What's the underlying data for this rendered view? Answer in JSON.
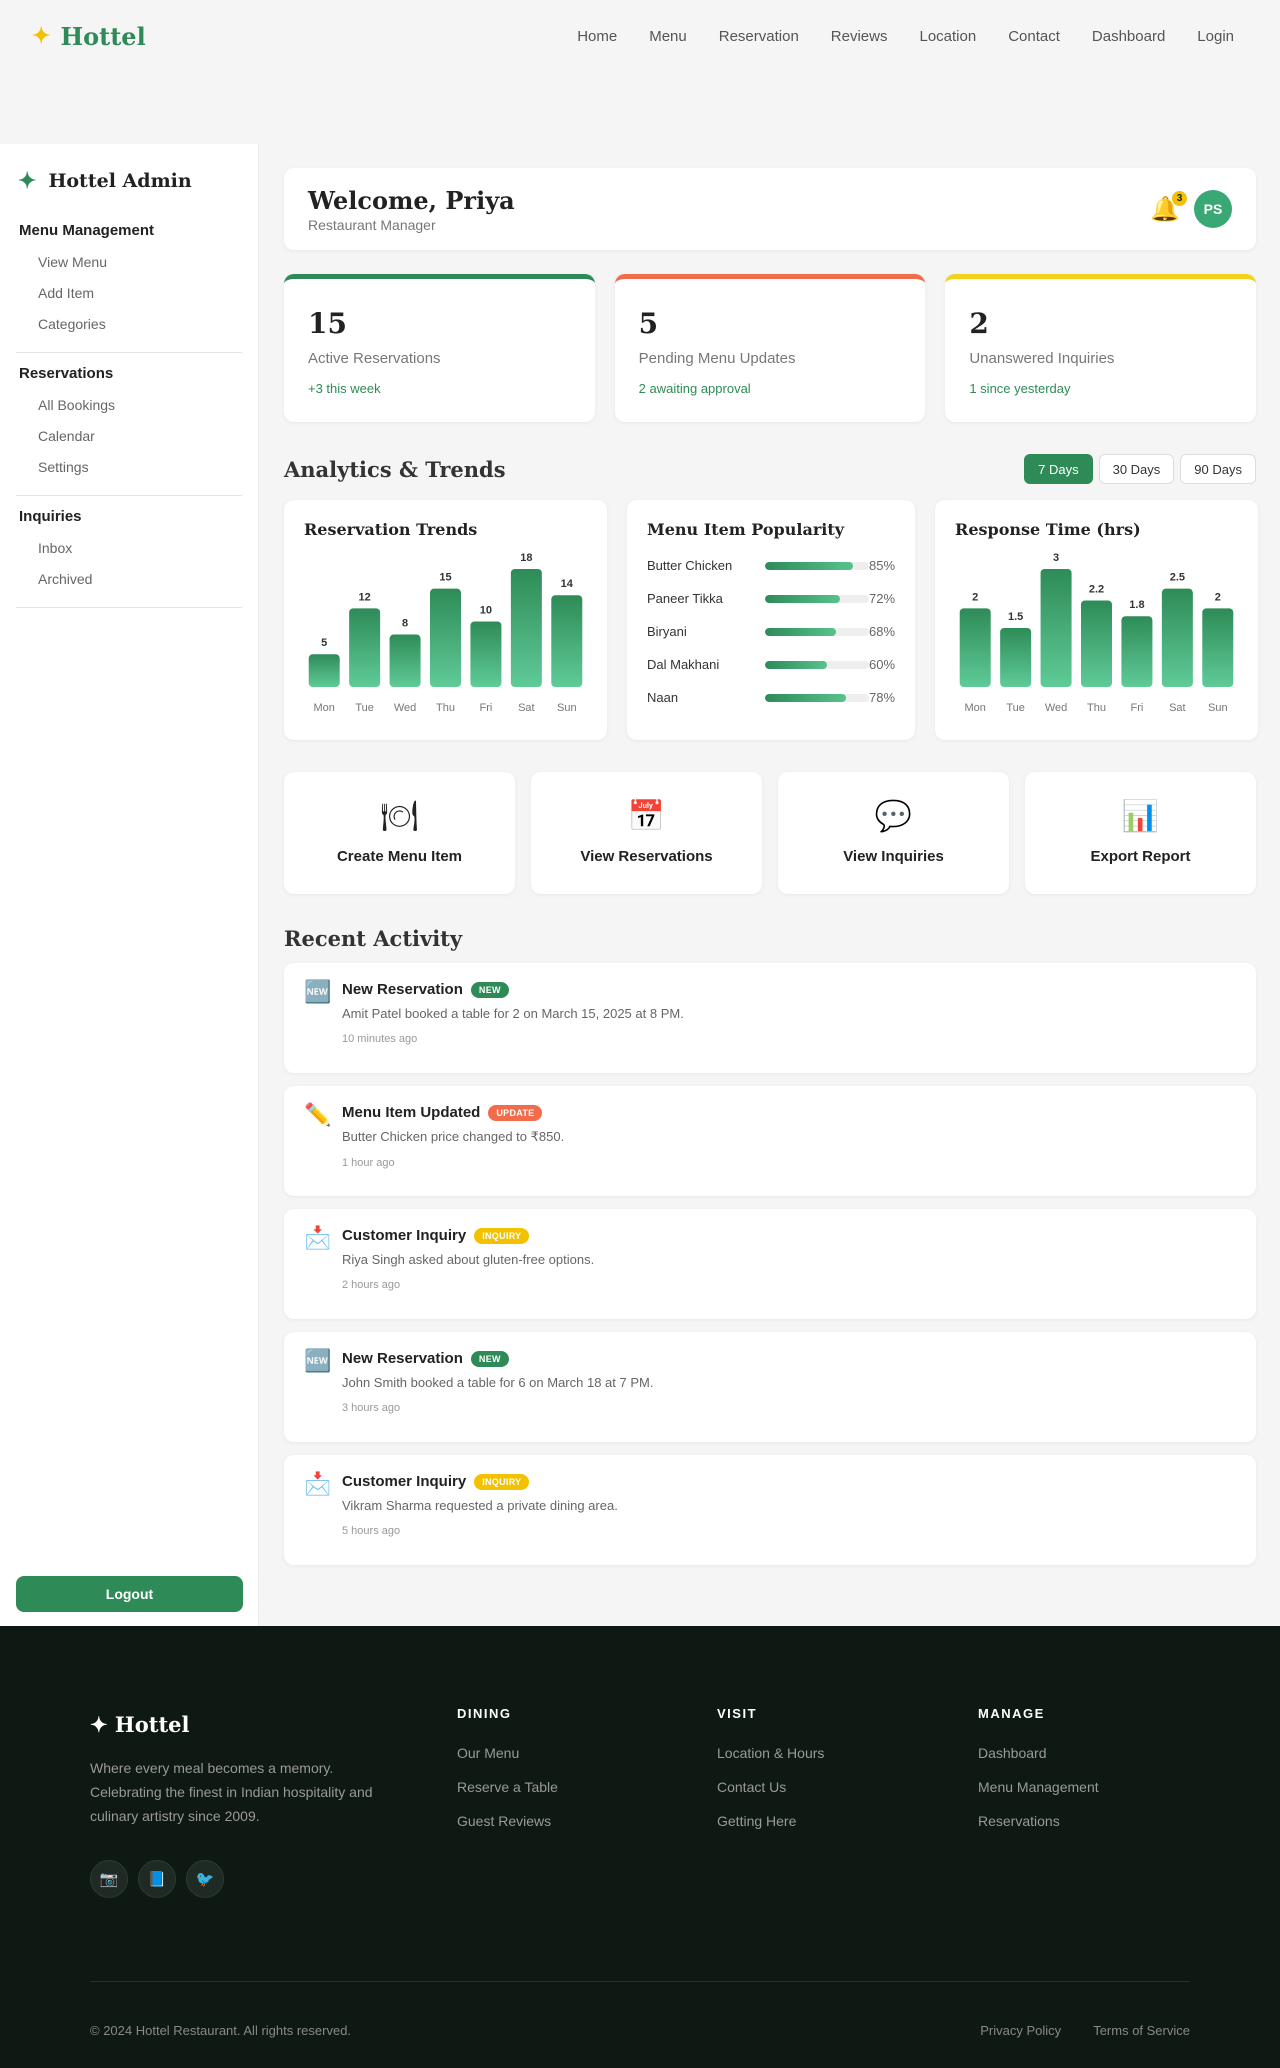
{
  "nav": {
    "brand": "Hottel",
    "links": [
      "Home",
      "Menu",
      "Reservation",
      "Reviews",
      "Location",
      "Contact",
      "Dashboard",
      "Login"
    ]
  },
  "sidebar": {
    "brand": "Hottel Admin",
    "groups": [
      {
        "title": "Menu Management",
        "items": [
          "View Menu",
          "Add Item",
          "Categories"
        ]
      },
      {
        "title": "Reservations",
        "items": [
          "All Bookings",
          "Calendar",
          "Settings"
        ]
      },
      {
        "title": "Inquiries",
        "items": [
          "Inbox",
          "Archived"
        ]
      }
    ],
    "logout": "Logout"
  },
  "header": {
    "welcome": "Welcome, Priya",
    "role": "Restaurant Manager",
    "notif_count": "3",
    "avatar": "PS"
  },
  "stats": [
    {
      "value": "15",
      "label": "Active Reservations",
      "delta": "+3 this week",
      "color": "#2e8b57"
    },
    {
      "value": "5",
      "label": "Pending Menu Updates",
      "delta": "2 awaiting approval",
      "color": "#f26b4a"
    },
    {
      "value": "2",
      "label": "Unanswered Inquiries",
      "delta": "1 since yesterday",
      "color": "#f2d21a"
    }
  ],
  "analytics": {
    "title": "Analytics & Trends",
    "ranges": [
      "7 Days",
      "30 Days",
      "90 Days"
    ],
    "active_range": "7 Days"
  },
  "chart_data": [
    {
      "type": "bar",
      "title": "Reservation Trends",
      "categories": [
        "Mon",
        "Tue",
        "Wed",
        "Thu",
        "Fri",
        "Sat",
        "Sun"
      ],
      "values": [
        5,
        12,
        8,
        15,
        10,
        18,
        14
      ],
      "labels": [
        "5",
        "12",
        "8",
        "15",
        "10",
        "18",
        "14"
      ],
      "ylim": [
        0,
        18
      ]
    },
    {
      "type": "bar",
      "title": "Menu Item Popularity",
      "categories": [
        "Butter Chicken",
        "Paneer Tikka",
        "Biryani",
        "Dal Makhani",
        "Naan"
      ],
      "values": [
        85,
        72,
        68,
        60,
        78
      ],
      "labels": [
        "85%",
        "72%",
        "68%",
        "60%",
        "78%"
      ],
      "ylim": [
        0,
        100
      ]
    },
    {
      "type": "bar",
      "title": "Response Time (hrs)",
      "categories": [
        "Mon",
        "Tue",
        "Wed",
        "Thu",
        "Fri",
        "Sat",
        "Sun"
      ],
      "values": [
        2,
        1.5,
        3,
        2.2,
        1.8,
        2.5,
        2
      ],
      "labels": [
        "2",
        "1.5",
        "3",
        "2.2",
        "1.8",
        "2.5",
        "2"
      ],
      "ylim": [
        0,
        3
      ]
    }
  ],
  "quick_actions": [
    {
      "icon": "🍽",
      "icon_name": "dining-icon",
      "label": "Create Menu Item"
    },
    {
      "icon": "📅",
      "icon_name": "calendar-icon",
      "label": "View Reservations"
    },
    {
      "icon": "💬",
      "icon_name": "chat-icon",
      "label": "View Inquiries"
    },
    {
      "icon": "📊",
      "icon_name": "chart-icon",
      "label": "Export Report"
    }
  ],
  "recent": {
    "title": "Recent Activity",
    "items": [
      {
        "icon": "🆕",
        "icon_name": "new-icon",
        "title": "New Reservation",
        "badge": "NEW",
        "badge_color": "#2e8b57",
        "desc": "Amit Patel booked a table for 2 on March 15, 2025 at 8 PM.",
        "time": "10 minutes ago"
      },
      {
        "icon": "✏️",
        "icon_name": "pencil-icon",
        "title": "Menu Item Updated",
        "badge": "UPDATE",
        "badge_color": "#f26b4a",
        "desc": "Butter Chicken price changed to ₹850.",
        "time": "1 hour ago"
      },
      {
        "icon": "📩",
        "icon_name": "envelope-icon",
        "title": "Customer Inquiry",
        "badge": "INQUIRY",
        "badge_color": "#f2c200",
        "desc": "Riya Singh asked about gluten-free options.",
        "time": "2 hours ago"
      },
      {
        "icon": "🆕",
        "icon_name": "new-icon",
        "title": "New Reservation",
        "badge": "NEW",
        "badge_color": "#2e8b57",
        "desc": "John Smith booked a table for 6 on March 18 at 7 PM.",
        "time": "3 hours ago"
      },
      {
        "icon": "📩",
        "icon_name": "envelope-icon",
        "title": "Customer Inquiry",
        "badge": "INQUIRY",
        "badge_color": "#f2c200",
        "desc": "Vikram Sharma requested a private dining area.",
        "time": "5 hours ago"
      }
    ]
  },
  "footer": {
    "brand": "✦ Hottel",
    "tagline": "Where every meal becomes a memory. Celebrating the finest in Indian hospitality and culinary artistry since 2009.",
    "socials": [
      {
        "icon": "📷",
        "icon_name": "camera-icon"
      },
      {
        "icon": "📘",
        "icon_name": "book-icon"
      },
      {
        "icon": "🐦",
        "icon_name": "bird-icon"
      }
    ],
    "columns": [
      {
        "title": "DINING",
        "links": [
          "Our Menu",
          "Reserve a Table",
          "Guest Reviews"
        ]
      },
      {
        "title": "VISIT",
        "links": [
          "Location & Hours",
          "Contact Us",
          "Getting Here"
        ]
      },
      {
        "title": "MANAGE",
        "links": [
          "Dashboard",
          "Menu Management",
          "Reservations"
        ]
      }
    ],
    "copyright": "© 2024 Hottel Restaurant. All rights reserved.",
    "legal": [
      "Privacy Policy",
      "Terms of Service"
    ]
  }
}
